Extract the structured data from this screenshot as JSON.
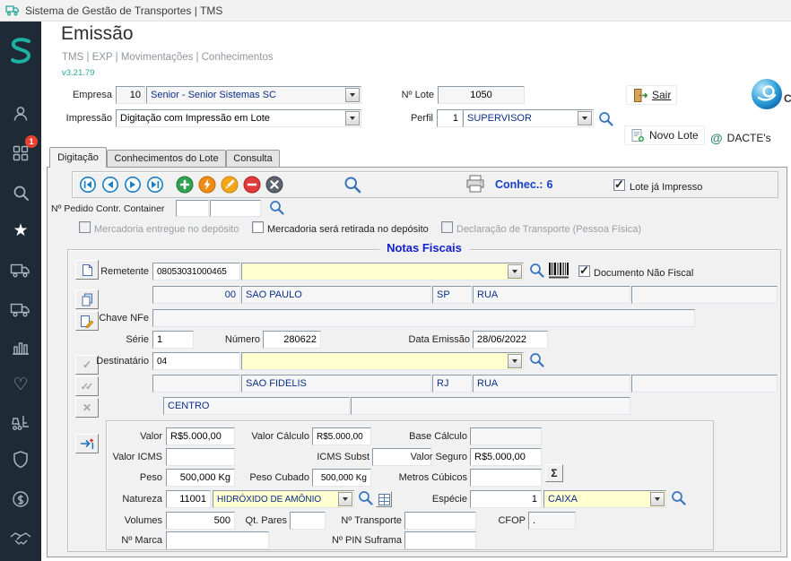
{
  "titlebar": {
    "title": "Sistema de Gestão de Transportes | TMS"
  },
  "sidebar": {
    "badge_count": "1"
  },
  "header": {
    "title": "Emissão",
    "breadcrumb": "TMS | EXP | Movimentações | Conhecimentos",
    "version": "v3.21.79"
  },
  "topform": {
    "empresa_label": "Empresa",
    "empresa_code": "10",
    "empresa_name": "Senior - Senior Sistemas SC",
    "lote_label": "Nº Lote",
    "lote_value": "1050",
    "impressao_label": "Impressão",
    "impressao_value": "Digitação com Impressão em Lote",
    "perfil_label": "Perfil",
    "perfil_code": "1",
    "perfil_name": "SUPERVISOR",
    "sair_label": "Sair",
    "novo_lote_label": "Novo Lote",
    "dactes_label": "DACTE's",
    "at_symbol": "@",
    "cut_text": "C"
  },
  "tabs": {
    "digitacao": "Digitação",
    "conhecimentos": "Conhecimentos do Lote",
    "consulta": "Consulta"
  },
  "toolbar": {
    "conhec_label": "Conhec.:",
    "conhec_value": "6",
    "lote_impresso_label": "Lote já Impresso",
    "lote_impresso_checked": true
  },
  "pedido": {
    "label": "Nº Pedido Contr. Container",
    "field1": "",
    "field2": ""
  },
  "options": {
    "entregue_label": "Mercadoria entregue no depósito",
    "entregue_checked": false,
    "retirada_label": "Mercadoria será retirada no depósito",
    "retirada_checked": false,
    "declaracao_label": "Declaração de Transporte (Pessoa Física)",
    "declaracao_checked": false
  },
  "notas": {
    "title": "Notas Fiscais",
    "remetente_label": "Remetente",
    "remetente_code": "08053031000465",
    "remetente_name": "",
    "doc_nao_fiscal_label": "Documento Não Fiscal",
    "doc_nao_fiscal_checked": true,
    "rem_city_code": "00",
    "rem_city": "SAO PAULO",
    "rem_uf": "SP",
    "rem_address_type": "RUA",
    "rem_address_extra": "",
    "chave_label": "Chave NFe",
    "chave_value": "",
    "serie_label": "Série",
    "serie_value": "1",
    "numero_label": "Número",
    "numero_value": "280622",
    "data_emissao_label": "Data Emissão",
    "data_emissao_value": "28/06/2022",
    "destinatario_label": "Destinatário",
    "destinatario_code": "04",
    "destinatario_name": "",
    "dest_city_code": "",
    "dest_city": "SAO FIDELIS",
    "dest_uf": "RJ",
    "dest_address_type": "RUA",
    "dest_address_extra": "",
    "bairro_value": "CENTRO",
    "complemento_value": "",
    "valor_label": "Valor",
    "valor_value": "R$5.000,00",
    "valor_calculo_label": "Valor Cálculo",
    "valor_calculo_value": "R$5.000,00",
    "base_calculo_label": "Base Cálculo",
    "base_calculo_value": "",
    "valor_icms_label": "Valor ICMS",
    "valor_icms_value": "",
    "icms_subst_label": "ICMS Subst",
    "icms_subst_value": "",
    "valor_seguro_label": "Valor Seguro",
    "valor_seguro_value": "R$5.000,00",
    "peso_label": "Peso",
    "peso_value": "500,000 Kg",
    "peso_cubado_label": "Peso Cubado",
    "peso_cubado_value": "500,000 Kg",
    "metros_cubicos_label": "Metros Cúbicos",
    "metros_cubicos_value": "",
    "sigma_symbol": "Σ",
    "natureza_label": "Natureza",
    "natureza_code": "11001",
    "natureza_name": "HIDRÓXIDO DE AMÔNIO",
    "especie_label": "Espécie",
    "especie_code": "1",
    "especie_name": "CAIXA",
    "volumes_label": "Volumes",
    "volumes_value": "500",
    "qt_pares_label": "Qt. Pares",
    "qt_pares_value": "",
    "n_transporte_label": "Nº Transporte",
    "n_transporte_value": "",
    "cfop_label": "CFOP",
    "cfop_value": ".",
    "n_marca_label": "Nº Marca",
    "n_marca_value": "",
    "n_pin_suframa_label": "Nº PIN Suframa",
    "n_pin_suframa_value": ""
  }
}
